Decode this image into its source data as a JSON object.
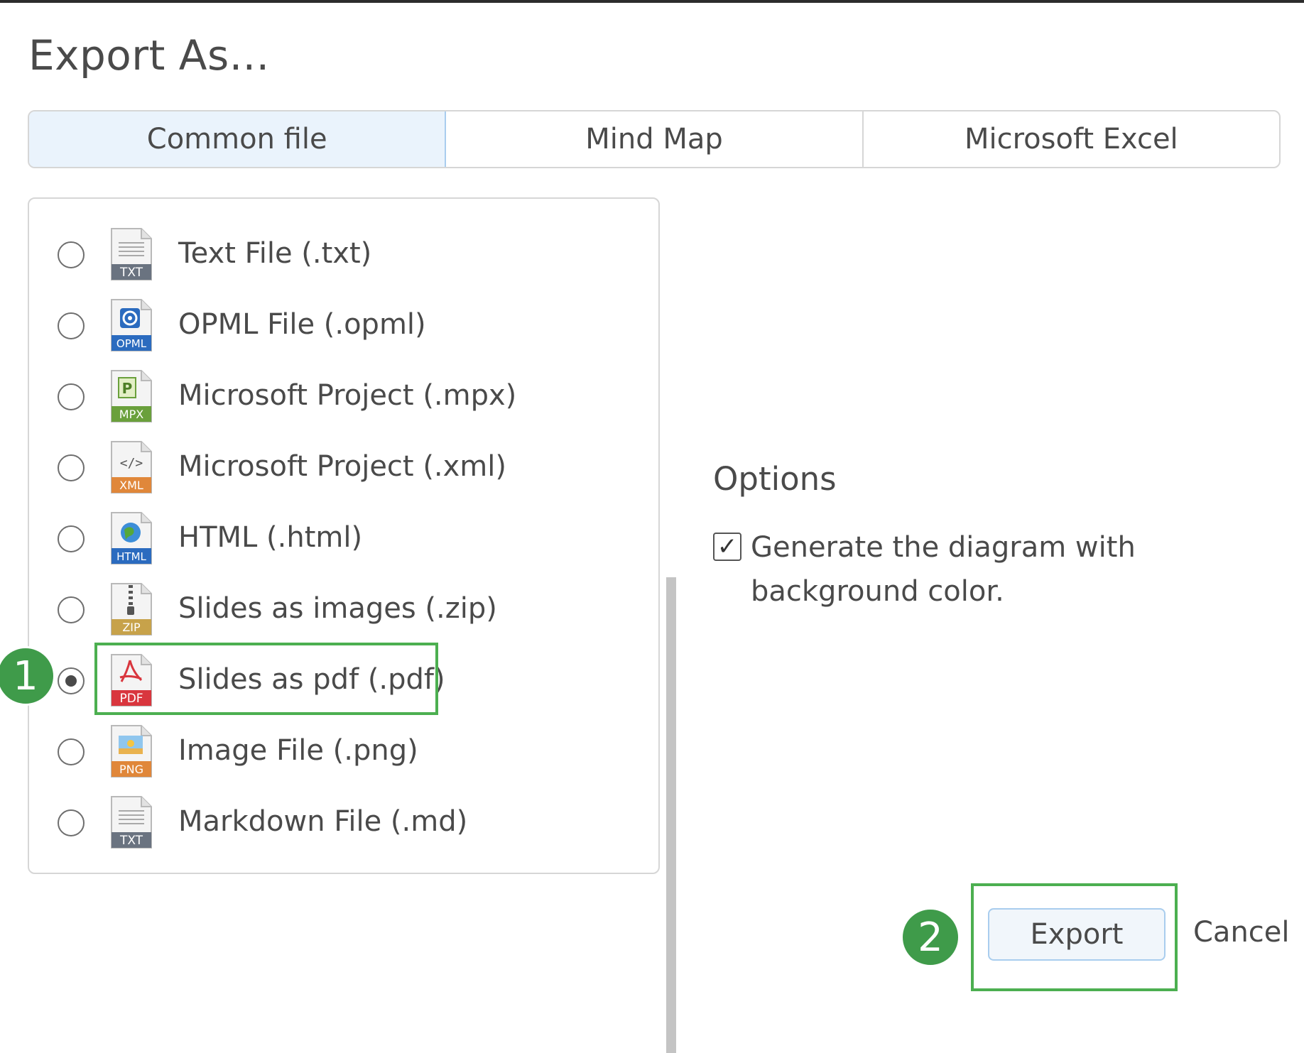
{
  "dialog": {
    "title": "Export As..."
  },
  "tabs": [
    {
      "label": "Common file",
      "active": true
    },
    {
      "label": "Mind Map",
      "active": false
    },
    {
      "label": "Microsoft Excel",
      "active": false
    }
  ],
  "formats": [
    {
      "label": "Text File (.txt)",
      "icon": "txt-file-icon",
      "badge": "TXT",
      "selected": false
    },
    {
      "label": "OPML File (.opml)",
      "icon": "opml-file-icon",
      "badge": "OPML",
      "selected": false
    },
    {
      "label": "Microsoft Project (.mpx)",
      "icon": "mpx-file-icon",
      "badge": "MPX",
      "selected": false
    },
    {
      "label": "Microsoft Project (.xml)",
      "icon": "xml-file-icon",
      "badge": "XML",
      "selected": false
    },
    {
      "label": "HTML (.html)",
      "icon": "html-file-icon",
      "badge": "HTML",
      "selected": false
    },
    {
      "label": "Slides as images (.zip)",
      "icon": "zip-file-icon",
      "badge": "ZIP",
      "selected": false
    },
    {
      "label": "Slides as pdf (.pdf)",
      "icon": "pdf-file-icon",
      "badge": "PDF",
      "selected": true
    },
    {
      "label": "Image File (.png)",
      "icon": "png-file-icon",
      "badge": "PNG",
      "selected": false
    },
    {
      "label": "Markdown File (.md)",
      "icon": "md-file-icon",
      "badge": "TXT",
      "selected": false
    }
  ],
  "options": {
    "title": "Options",
    "background_checkbox": {
      "checked": true,
      "label": "Generate the diagram with background color."
    }
  },
  "annotations": {
    "step1": "1",
    "step2": "2"
  },
  "buttons": {
    "export": "Export",
    "cancel": "Cancel"
  },
  "colors": {
    "highlight": "#4caf50",
    "step_badge": "#3f9b4a",
    "active_tab_bg": "#eaf3fc",
    "pdf_red": "#d9363e"
  }
}
